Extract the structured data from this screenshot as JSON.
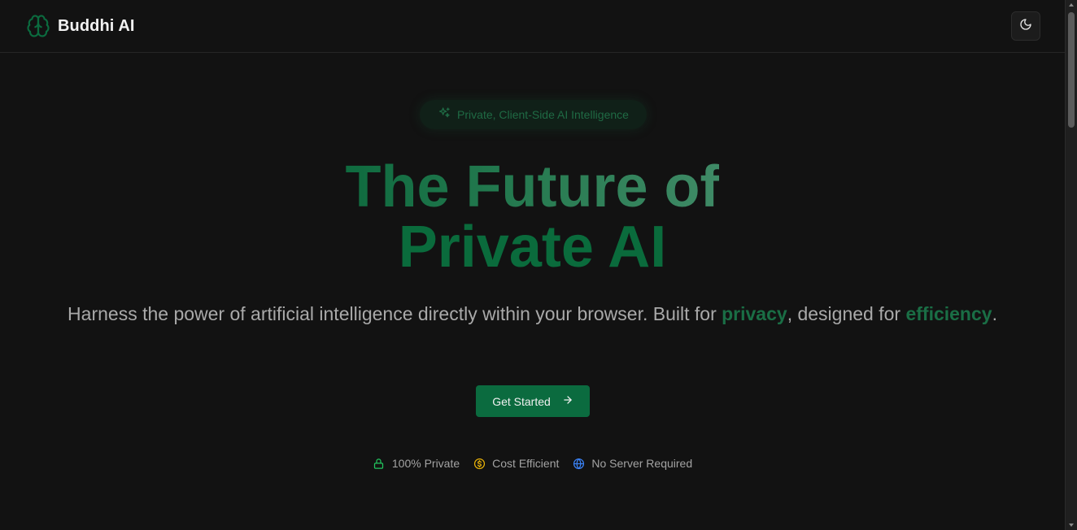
{
  "header": {
    "brand_name": "Buddhi AI",
    "brand_icon": "brain-icon",
    "theme_toggle_icon": "moon-icon"
  },
  "hero": {
    "badge": {
      "icon": "sparkles-icon",
      "text": "Private, Client-Side AI Intelligence"
    },
    "headline": {
      "line1": "The Future of",
      "line2": "Private AI"
    },
    "subtitle": {
      "part1": "Harness the power of artificial intelligence directly within your browser. Built for ",
      "highlight1": "privacy",
      "part2": ", designed for ",
      "highlight2": "efficiency",
      "part3": "."
    },
    "cta": {
      "label": "Get Started",
      "icon": "arrow-right-icon"
    },
    "features": [
      {
        "icon": "lock-icon",
        "label": "100% Private",
        "color": "#22c55e"
      },
      {
        "icon": "dollar-coin-icon",
        "label": "Cost Efficient",
        "color": "#eab308"
      },
      {
        "icon": "globe-icon",
        "label": "No Server Required",
        "color": "#3b82f6"
      }
    ]
  },
  "colors": {
    "background": "#121212",
    "accent": "#0b6b3f",
    "accent_text": "#1a6e45"
  }
}
